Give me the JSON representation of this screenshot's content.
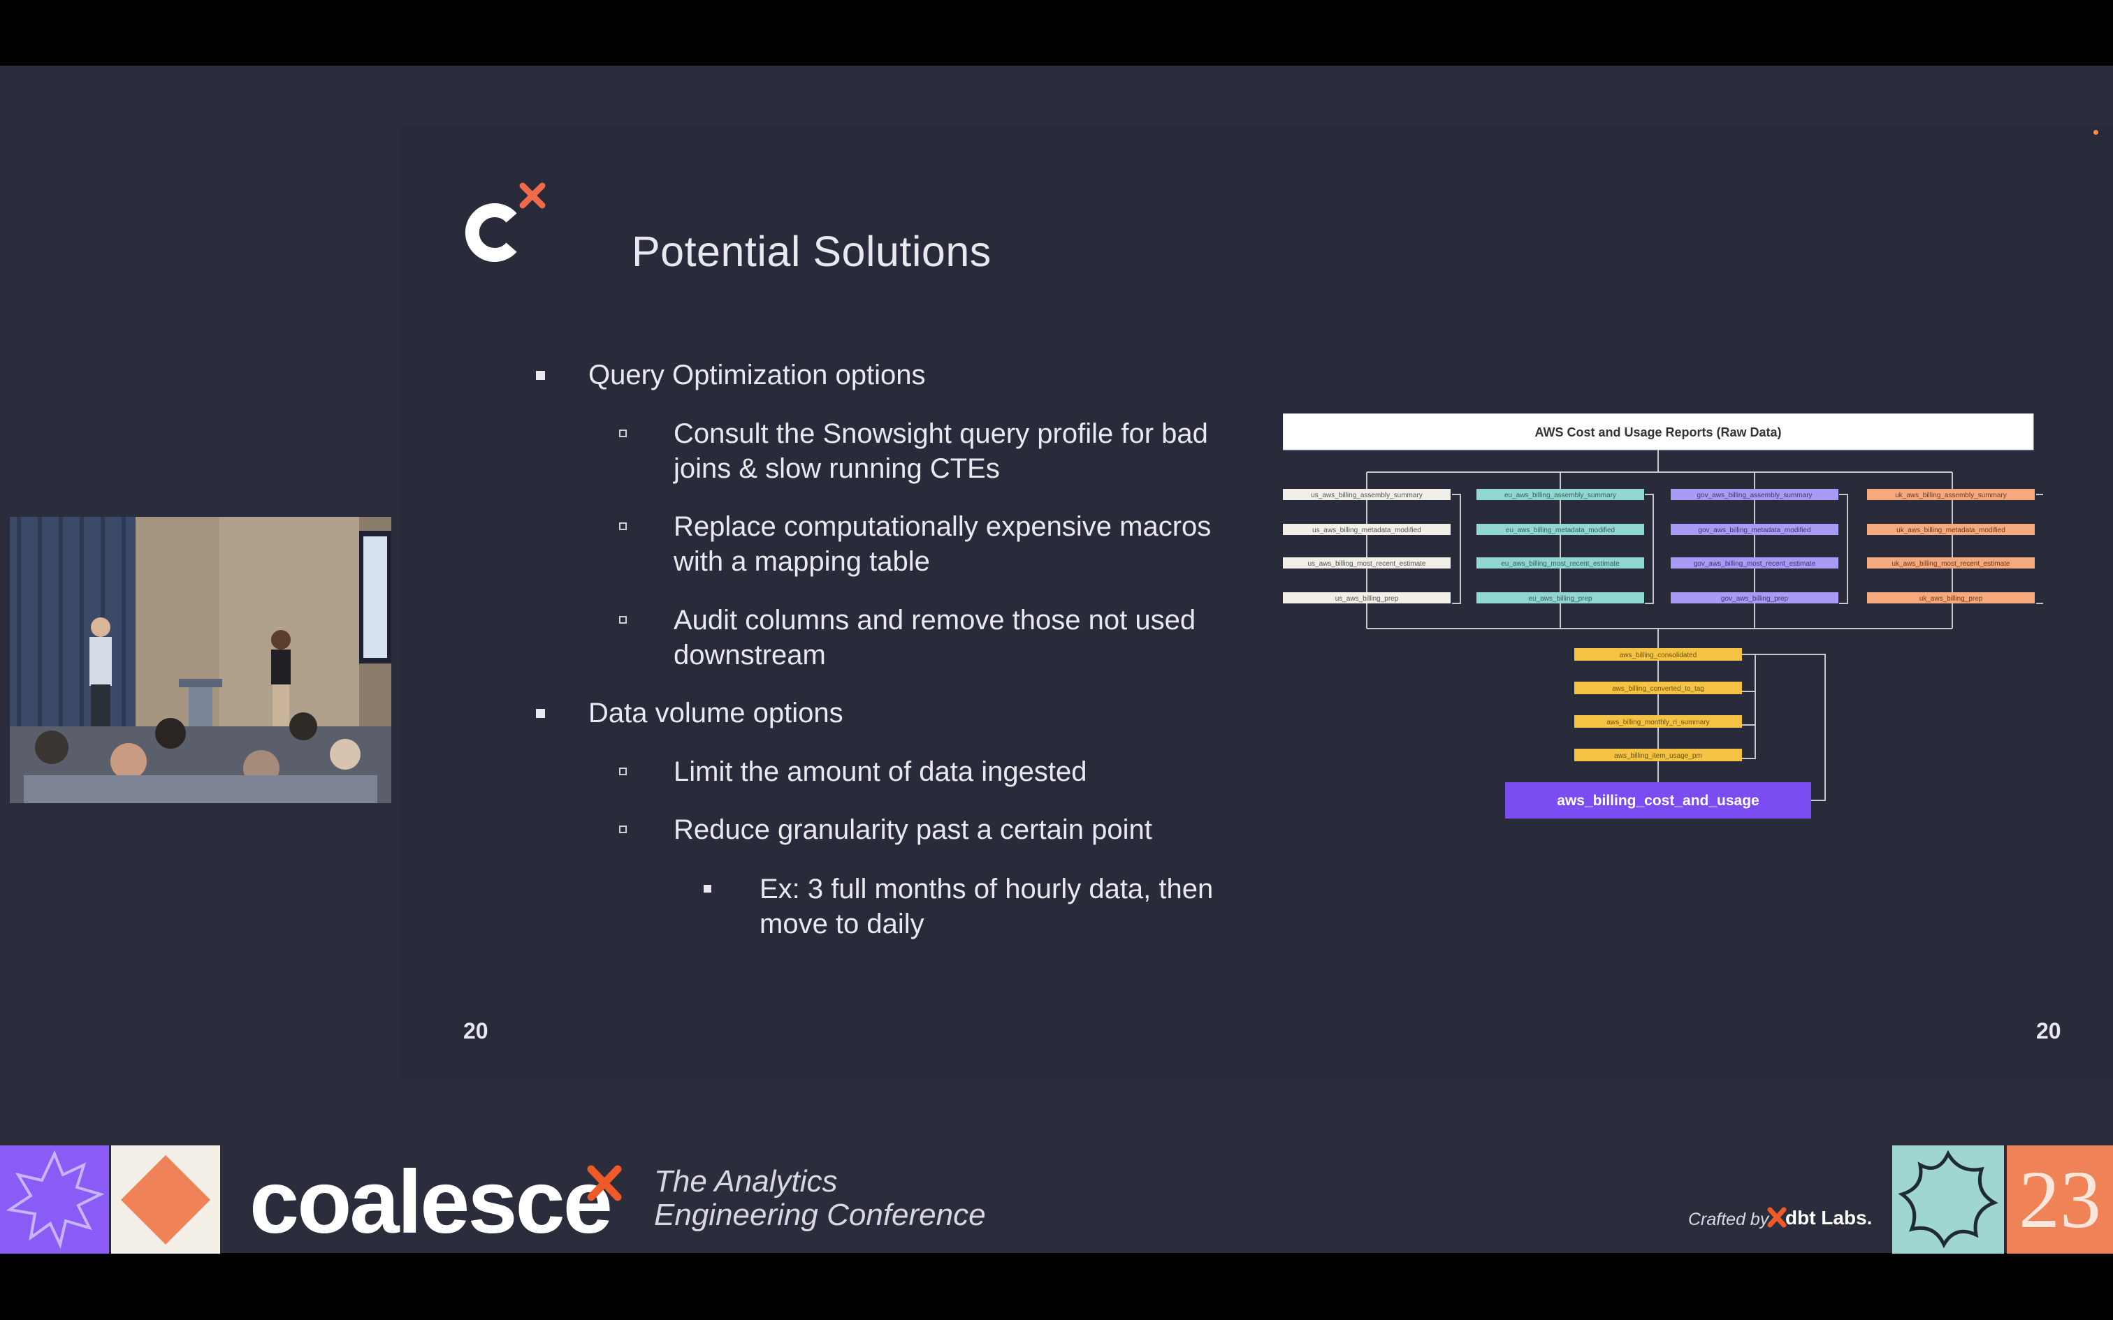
{
  "slide": {
    "title": "Potential Solutions",
    "page_number_left": "20",
    "page_number_right": "20",
    "bullets": [
      {
        "level": 1,
        "text": "Query Optimization options"
      },
      {
        "level": 2,
        "text": "Consult the Snowsight query profile for bad"
      },
      {
        "level": 2,
        "text": "joins & slow running CTEs"
      },
      {
        "level": 2,
        "text": "Replace computationally expensive macros"
      },
      {
        "level": 2,
        "text": "with a mapping table"
      },
      {
        "level": 2,
        "text": "Audit columns and remove those not used"
      },
      {
        "level": 2,
        "text": "downstream"
      },
      {
        "level": 1,
        "text": "Data volume options"
      },
      {
        "level": 2,
        "text": "Limit the amount of data ingested"
      },
      {
        "level": 2,
        "text": "Reduce granularity past a certain point"
      },
      {
        "level": 3,
        "text": "Ex: 3 full months of hourly data, then"
      },
      {
        "level": 3,
        "text": "move to daily"
      }
    ]
  },
  "diagram": {
    "header": "AWS Cost and Usage Reports (Raw Data)",
    "columns": [
      {
        "color": "#f2efe8",
        "nodes": [
          "us_aws_billing_assembly_summary",
          "us_aws_billing_metadata_modified",
          "us_aws_billing_most_recent_estimate",
          "us_aws_billing_prep"
        ]
      },
      {
        "color": "#8fd7d0",
        "nodes": [
          "eu_aws_billing_assembly_summary",
          "eu_aws_billing_metadata_modified",
          "eu_aws_billing_most_recent_estimate",
          "eu_aws_billing_prep"
        ]
      },
      {
        "color": "#a99bf5",
        "nodes": [
          "gov_aws_billing_assembly_summary",
          "gov_aws_billing_metadata_modified",
          "gov_aws_billing_most_recent_estimate",
          "gov_aws_billing_prep"
        ]
      },
      {
        "color": "#f5a97c",
        "nodes": [
          "uk_aws_billing_assembly_summary",
          "uk_aws_billing_metadata_modified",
          "uk_aws_billing_most_recent_estimate",
          "uk_aws_billing_prep"
        ]
      }
    ],
    "middle": {
      "color": "#f5c343",
      "nodes": [
        "aws_billing_consolidated",
        "aws_billing_converted_to_tag",
        "aws_billing_monthly_ri_summary",
        "aws_billing_item_usage_pm"
      ]
    },
    "final": {
      "label": "aws_billing_cost_and_usage",
      "color": "#7b4cf2"
    }
  },
  "footer": {
    "brand": "coalesce",
    "tagline_line1": "The Analytics",
    "tagline_line2": "Engineering Conference",
    "crafted_by": "Crafted by",
    "dbt": "dbt Labs.",
    "year": "23"
  },
  "colors": {
    "accent_orange": "#f05a28",
    "tile_purple": "#8a5cf5",
    "tile_cream": "#f4efe6",
    "tile_teal": "#9fd6d2",
    "tile_peach": "#f08257"
  }
}
